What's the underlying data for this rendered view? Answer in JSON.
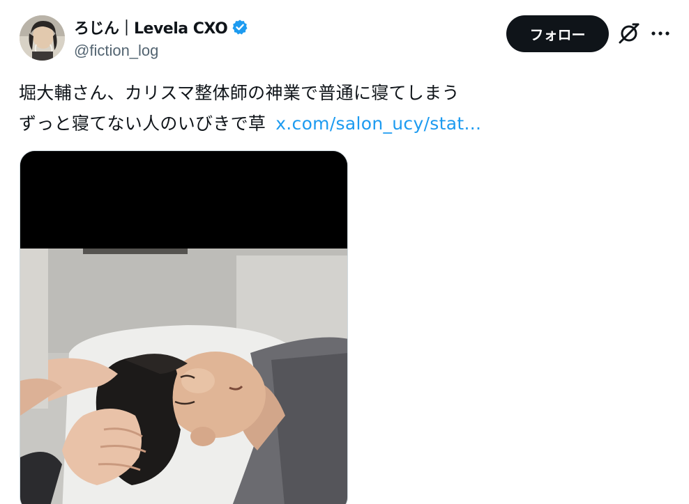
{
  "user": {
    "display_name": "ろじん｜Levela CXO",
    "handle": "@fiction_log",
    "verified": true,
    "avatar_icon": "avatar-icon"
  },
  "actions": {
    "follow_label": "フォロー",
    "grok_icon": "grok-icon",
    "more_icon": "more-dots-icon"
  },
  "tweet": {
    "line1": "堀大輔さん、カリスマ整体師の神業で普通に寝てしまう",
    "line2": "ずっと寝てない人のいびきで草",
    "link_text": "x.com/salon_ucy/stat..."
  },
  "colors": {
    "text": "#0f1419",
    "secondary": "#536471",
    "link": "#1d9bf0",
    "verified": "#1d9bf0",
    "button": "#0f1419"
  }
}
